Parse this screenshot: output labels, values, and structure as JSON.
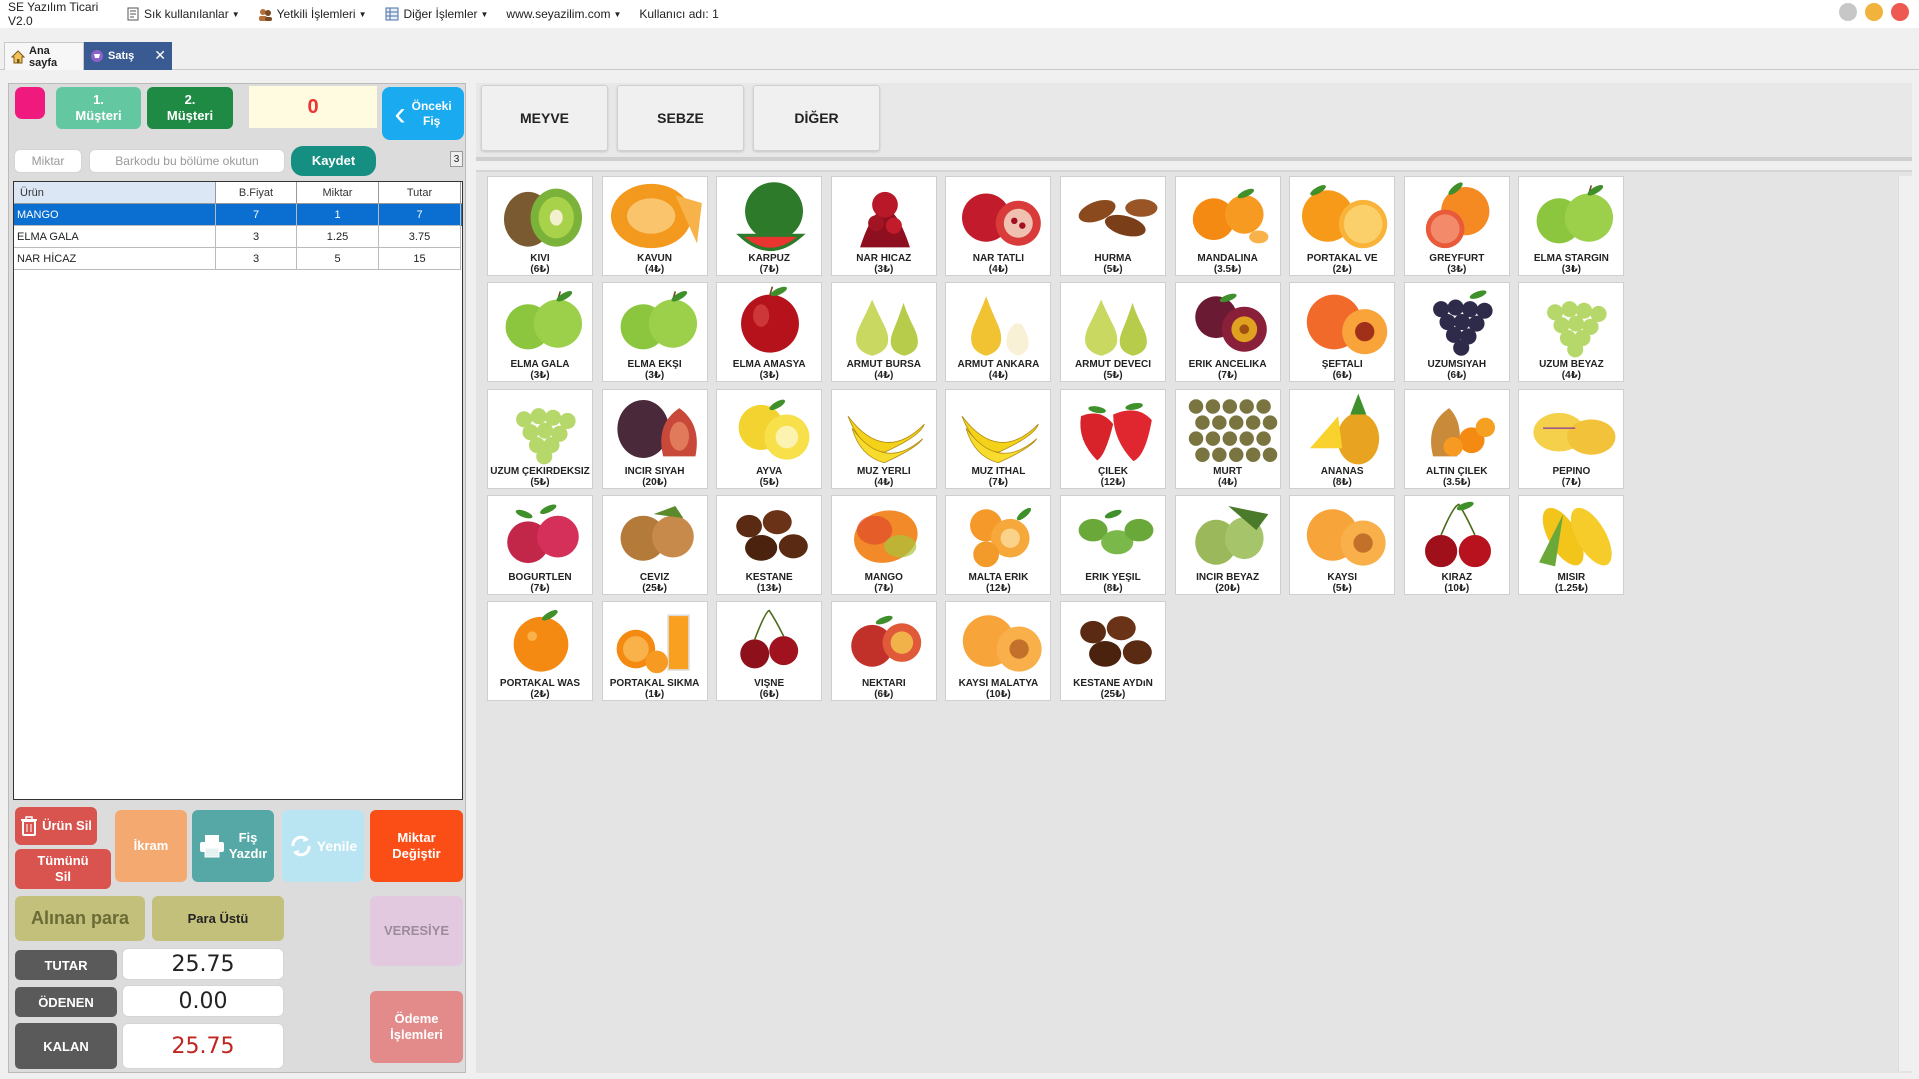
{
  "app": {
    "title": "SE Yazılım Ticari V2.0",
    "menus": [
      {
        "label": "Sık kullanılanlar"
      },
      {
        "label": "Yetkili İşlemleri"
      },
      {
        "label": "Diğer İşlemler"
      },
      {
        "label": "www.seyazilim.com"
      }
    ],
    "user_label": "Kullanıcı adı: 1",
    "colors": {
      "win_min": "#c7c7c7",
      "win_max": "#f2b33d",
      "win_close": "#ee5a52"
    }
  },
  "tabs": [
    {
      "label": "Ana sayfa",
      "icon": "home-icon"
    },
    {
      "label": "Satış",
      "icon": "cart-icon"
    }
  ],
  "sale": {
    "customer1": [
      "1.",
      "Müşteri"
    ],
    "customer2": [
      "2.",
      "Müşteri"
    ],
    "counter": "0",
    "prev_receipt": [
      "Önceki",
      "Fiş"
    ],
    "qty_placeholder": "Miktar",
    "barcode_placeholder": "Barkodu bu bölüme okutun",
    "save_label": "Kaydet",
    "mini_badge": "3",
    "columns": [
      "Ürün",
      "B.Fiyat",
      "Miktar",
      "Tutar"
    ],
    "rows": [
      {
        "product": "MANGO",
        "price": "7",
        "qty": "1",
        "total": "7"
      },
      {
        "product": "ELMA GALA",
        "price": "3",
        "qty": "1.25",
        "total": "3.75"
      },
      {
        "product": "NAR HİCAZ",
        "price": "3",
        "qty": "5",
        "total": "15"
      }
    ],
    "buttons": {
      "delete_item": "Ürün Sil",
      "delete_all": [
        "Tümünü",
        "Sil"
      ],
      "ikram": "İkram",
      "print": [
        "Fiş",
        "Yazdır"
      ],
      "refresh": "Yenile",
      "change_qty": [
        "Miktar",
        "Değiştir"
      ],
      "paid_money": "Alınan para",
      "change": "Para Üstü",
      "veresiye": "VERESİYE",
      "payment_ops": [
        "Ödeme",
        "İşlemleri"
      ]
    },
    "totals": {
      "tutar_label": "TUTAR",
      "tutar_value": "25.75",
      "odenen_label": "ÖDENEN",
      "odenen_value": "0.00",
      "kalan_label": "KALAN",
      "kalan_value": "25.75"
    }
  },
  "categories": [
    "MEYVE",
    "SEBZE",
    "DİĞER"
  ],
  "products": [
    {
      "name": "KIVI",
      "price": "(6₺)",
      "icon": "kiwi"
    },
    {
      "name": "KAVUN",
      "price": "(4₺)",
      "icon": "melon"
    },
    {
      "name": "KARPUZ",
      "price": "(7₺)",
      "icon": "watermelon"
    },
    {
      "name": "NAR HICAZ",
      "price": "(3₺)",
      "icon": "pomegranate-seeds"
    },
    {
      "name": "NAR TATLI",
      "price": "(4₺)",
      "icon": "pomegranate"
    },
    {
      "name": "HURMA",
      "price": "(5₺)",
      "icon": "dates"
    },
    {
      "name": "MANDALINA",
      "price": "(3.5₺)",
      "icon": "mandarin"
    },
    {
      "name": "PORTAKAL VE",
      "price": "(2₺)",
      "icon": "orange-half"
    },
    {
      "name": "GREYFURT",
      "price": "(3₺)",
      "icon": "grapefruit"
    },
    {
      "name": "ELMA STARGIN",
      "price": "(3₺)",
      "icon": "green-apple"
    },
    {
      "name": "ELMA GALA",
      "price": "(3₺)",
      "icon": "green-apple"
    },
    {
      "name": "ELMA EKŞI",
      "price": "(3₺)",
      "icon": "green-apple"
    },
    {
      "name": "ELMA AMASYA",
      "price": "(3₺)",
      "icon": "red-apple"
    },
    {
      "name": "ARMUT BURSA",
      "price": "(4₺)",
      "icon": "pear"
    },
    {
      "name": "ARMUT ANKARA",
      "price": "(4₺)",
      "icon": "pear-yellow"
    },
    {
      "name": "ARMUT DEVECI",
      "price": "(5₺)",
      "icon": "pear"
    },
    {
      "name": "ERIK ANCELIKA",
      "price": "(7₺)",
      "icon": "plum"
    },
    {
      "name": "ŞEFTALI",
      "price": "(6₺)",
      "icon": "peach"
    },
    {
      "name": "UZUMSIYAH",
      "price": "(6₺)",
      "icon": "black-grapes"
    },
    {
      "name": "UZUM BEYAZ",
      "price": "(4₺)",
      "icon": "green-grapes"
    },
    {
      "name": "UZUM ÇEKIRDEKSIZ",
      "price": "(5₺)",
      "icon": "green-grapes"
    },
    {
      "name": "INCIR SIYAH",
      "price": "(20₺)",
      "icon": "fig"
    },
    {
      "name": "AYVA",
      "price": "(5₺)",
      "icon": "quince"
    },
    {
      "name": "MUZ YERLI",
      "price": "(4₺)",
      "icon": "banana"
    },
    {
      "name": "MUZ ITHAL",
      "price": "(7₺)",
      "icon": "banana"
    },
    {
      "name": "ÇILEK",
      "price": "(12₺)",
      "icon": "strawberry"
    },
    {
      "name": "MURT",
      "price": "(4₺)",
      "icon": "myrtle"
    },
    {
      "name": "ANANAS",
      "price": "(8₺)",
      "icon": "pineapple"
    },
    {
      "name": "ALTIN ÇILEK",
      "price": "(3.5₺)",
      "icon": "physalis"
    },
    {
      "name": "PEPINO",
      "price": "(7₺)",
      "icon": "pepino"
    },
    {
      "name": "BOGURTLEN",
      "price": "(7₺)",
      "icon": "raspberry"
    },
    {
      "name": "CEVIZ",
      "price": "(25₺)",
      "icon": "walnut"
    },
    {
      "name": "KESTANE",
      "price": "(13₺)",
      "icon": "chestnut"
    },
    {
      "name": "MANGO",
      "price": "(7₺)",
      "icon": "mango"
    },
    {
      "name": "MALTA ERIK",
      "price": "(12₺)",
      "icon": "loquat"
    },
    {
      "name": "ERIK YEŞIL",
      "price": "(8₺)",
      "icon": "green-plum"
    },
    {
      "name": "INCIR BEYAZ",
      "price": "(20₺)",
      "icon": "green-fig"
    },
    {
      "name": "KAYSI",
      "price": "(5₺)",
      "icon": "apricot"
    },
    {
      "name": "KIRAZ",
      "price": "(10₺)",
      "icon": "cherry"
    },
    {
      "name": "MISIR",
      "price": "(1.25₺)",
      "icon": "corn"
    },
    {
      "name": "PORTAKAL WAS",
      "price": "(2₺)",
      "icon": "orange"
    },
    {
      "name": "PORTAKAL SIKMA",
      "price": "(1₺)",
      "icon": "orange-juice"
    },
    {
      "name": "VIŞNE",
      "price": "(6₺)",
      "icon": "sour-cherry"
    },
    {
      "name": "NEKTARI",
      "price": "(6₺)",
      "icon": "nectarine"
    },
    {
      "name": "KAYSI MALATYA",
      "price": "(10₺)",
      "icon": "apricot"
    },
    {
      "name": "KESTANE AYDıN",
      "price": "(25₺)",
      "icon": "chestnut"
    }
  ]
}
